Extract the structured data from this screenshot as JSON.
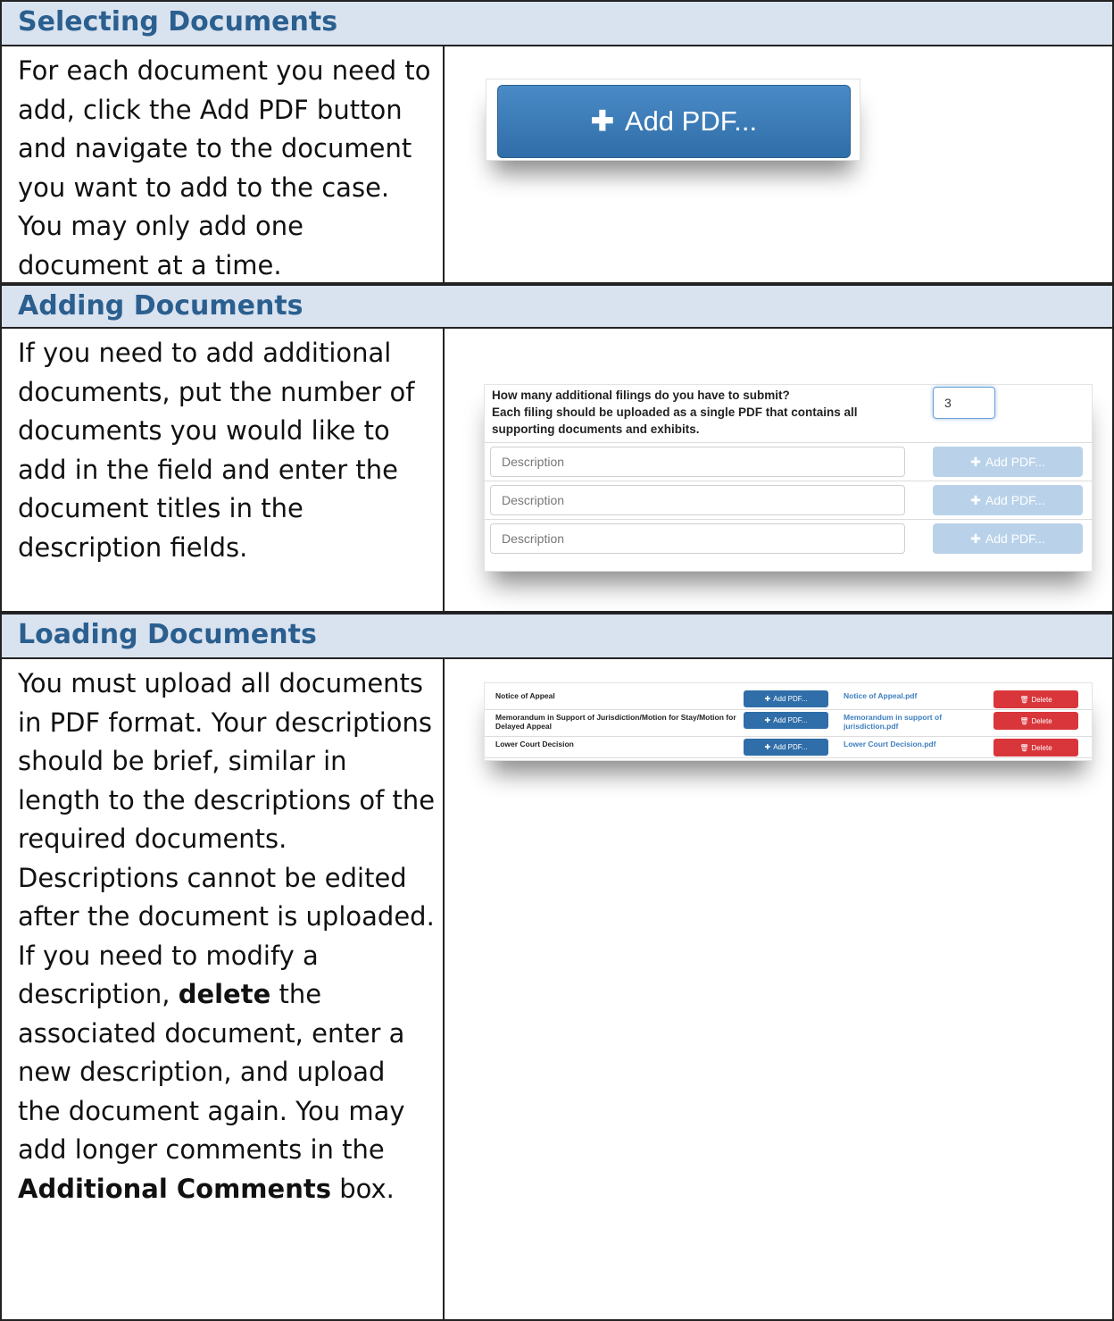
{
  "sections": [
    {
      "title": "Selecting Documents"
    },
    {
      "title": "Adding Documents"
    },
    {
      "title": "Loading Documents"
    }
  ],
  "selecting": {
    "text": "For each document you need to add, click the Add PDF button and navigate to the document you want to add to the case. You may only add one document at a time.",
    "button_label": "Add PDF...",
    "button_icon": "plus-icon"
  },
  "adding": {
    "text": "If you need to add additional documents, put the number of documents you would like to add in the field and enter the document titles in the description fields.",
    "question_line1": "How many additional filings do you have to submit?",
    "question_line2": "Each filing should be uploaded as a single PDF that contains all supporting documents and exhibits.",
    "count_value": "3",
    "rows": [
      {
        "placeholder": "Description",
        "button_label": "Add PDF..."
      },
      {
        "placeholder": "Description",
        "button_label": "Add PDF..."
      },
      {
        "placeholder": "Description",
        "button_label": "Add PDF..."
      }
    ]
  },
  "loading": {
    "text_part1": "You must upload all documents in PDF format. Your descriptions should be brief, similar in length to the descriptions of the required documents. Descriptions cannot be edited after the document is uploaded. If you need to modify a description,",
    "bold1": "delete",
    "text_part2": "the associated document, enter a new description, and upload the document again. You may add longer comments in the",
    "bold2": "Additional Comments",
    "text_part3": "box.",
    "documents": [
      {
        "title": "Notice of Appeal",
        "add_label": "Add PDF...",
        "file": "Notice of Appeal.pdf",
        "delete_label": "Delete"
      },
      {
        "title": "Memorandum in Support of Jurisdiction/Motion for Stay/Motion for Delayed Appeal",
        "add_label": "Add PDF...",
        "file": "Memorandum in support of jurisdiction.pdf",
        "delete_label": "Delete"
      },
      {
        "title": "Lower Court Decision",
        "add_label": "Add PDF...",
        "file": "Lower Court Decision.pdf",
        "delete_label": "Delete"
      }
    ]
  },
  "colors": {
    "header_bg": "#d9e2ef",
    "header_text": "#2a5f8f",
    "primary_button": "#2f6ea8",
    "disabled_button": "#b9d2ea",
    "delete_button": "#d9363b",
    "link_text": "#3f7fbf"
  }
}
